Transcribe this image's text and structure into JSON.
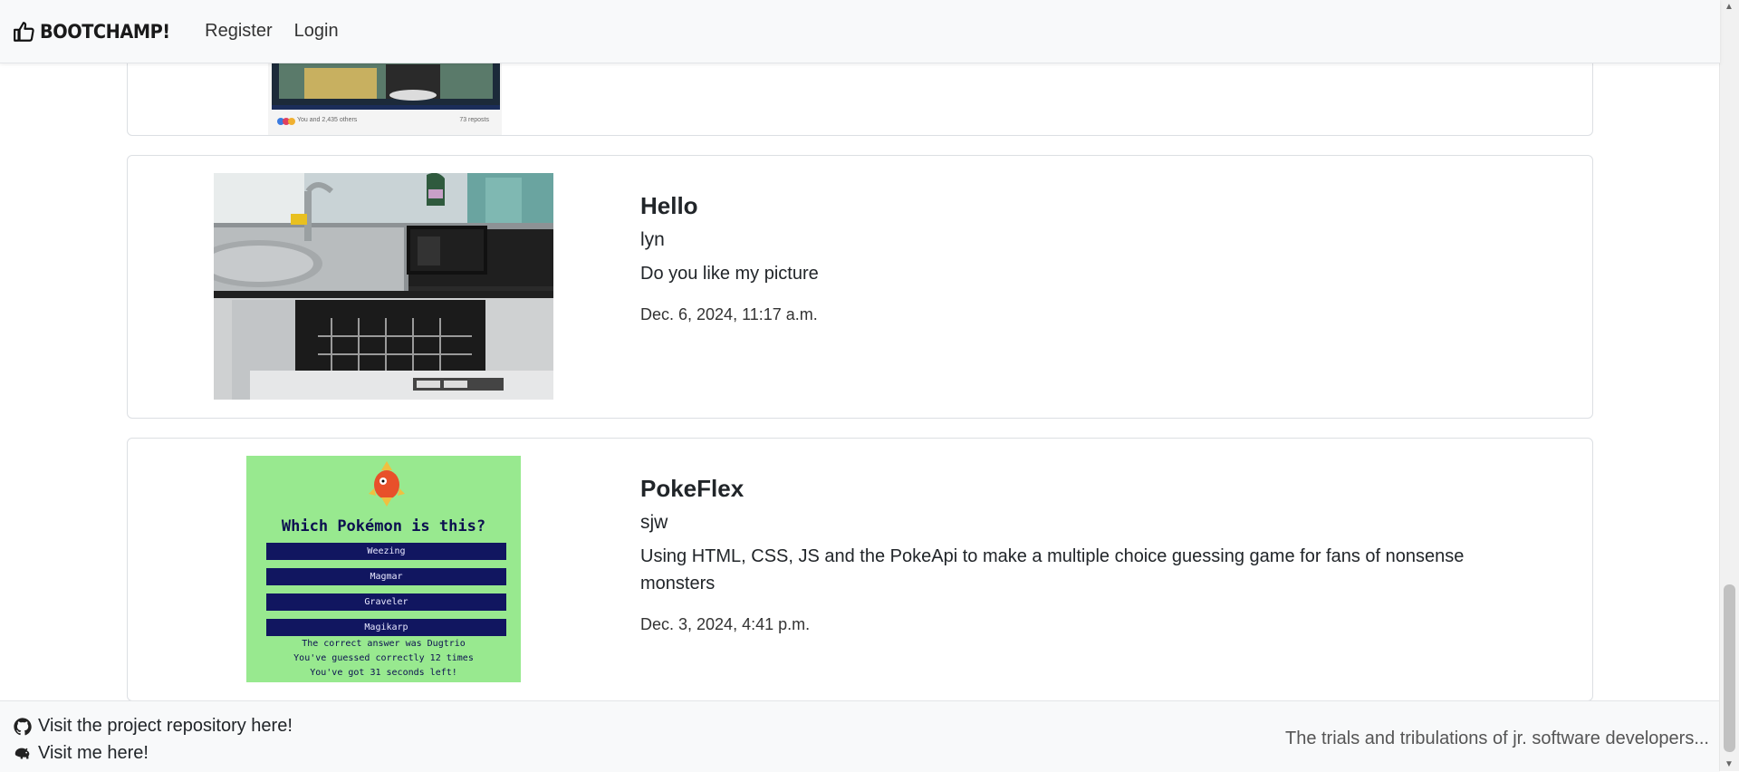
{
  "navbar": {
    "brand": "BOOTCHAMP!",
    "brand_icon": "thumbs-up-icon",
    "links": [
      "Register",
      "Login"
    ]
  },
  "preview_card": {
    "likes_text": "You and 2,435 others",
    "reposts_text": "73 reposts"
  },
  "posts": [
    {
      "title": "Hello",
      "author": "lyn",
      "description": "Do you like my picture",
      "date": "Dec. 6, 2024, 11:17 a.m.",
      "image": "kitchen-sink-dishwasher-photo"
    },
    {
      "title": "PokeFlex",
      "author": "sjw",
      "description": "Using HTML, CSS, JS and the PokeApi to make a multiple choice guessing game for fans of nonsense monsters",
      "date": "Dec. 3, 2024, 4:41 p.m.",
      "image": "pokemon-quiz-screenshot",
      "screenshot": {
        "heading": "Which Pokémon is this?",
        "options": [
          "Weezing",
          "Magmar",
          "Graveler",
          "Magikarp"
        ],
        "lines": [
          "The correct answer was Dugtrio",
          "You've guessed correctly 12 times",
          "You've got 31 seconds left!"
        ]
      }
    }
  ],
  "footer": {
    "repo_link": "Visit the project repository here!",
    "me_link": "Visit me here!",
    "tagline": "The trials and tribulations of jr. software developers..."
  },
  "colors": {
    "navbar_bg": "#f8f9fa",
    "card_border": "#dcdfe3",
    "quiz_green": "#98e98f",
    "quiz_button": "#111660"
  }
}
